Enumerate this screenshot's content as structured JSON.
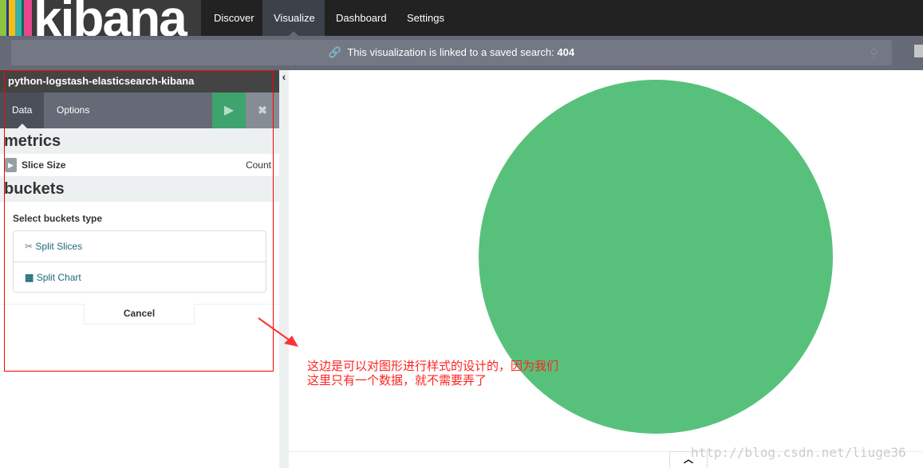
{
  "nav": {
    "logo": "kibana",
    "items": [
      {
        "label": "Discover"
      },
      {
        "label": "Visualize",
        "active": true
      },
      {
        "label": "Dashboard"
      },
      {
        "label": "Settings"
      }
    ]
  },
  "search": {
    "prefix": "This visualization is linked to a saved search:",
    "name": "404"
  },
  "panel": {
    "title": "python-logstash-elasticsearch-kibana",
    "tabs": [
      {
        "label": "Data"
      },
      {
        "label": "Options"
      }
    ],
    "metrics": {
      "heading": "metrics",
      "item_label": "Slice Size",
      "item_value": "Count"
    },
    "buckets": {
      "heading": "buckets",
      "select_label": "Select buckets type",
      "options": [
        {
          "label": "Split Slices",
          "icon": "scissors-icon"
        },
        {
          "label": "Split Chart",
          "icon": "grid-icon"
        }
      ],
      "cancel": "Cancel"
    }
  },
  "chart_data": {
    "type": "pie",
    "values": [
      1
    ],
    "colors": [
      "#57c17b"
    ]
  },
  "annotation": {
    "line1": "这边是可以对图形进行样式的设计的，因为我们",
    "line2": "这里只有一个数据，就不需要弄了"
  },
  "watermark": "http://blog.csdn.net/liuge36",
  "colors": {
    "accent": "#3fa36e",
    "nav": "#222222",
    "pie": "#57c17b"
  }
}
